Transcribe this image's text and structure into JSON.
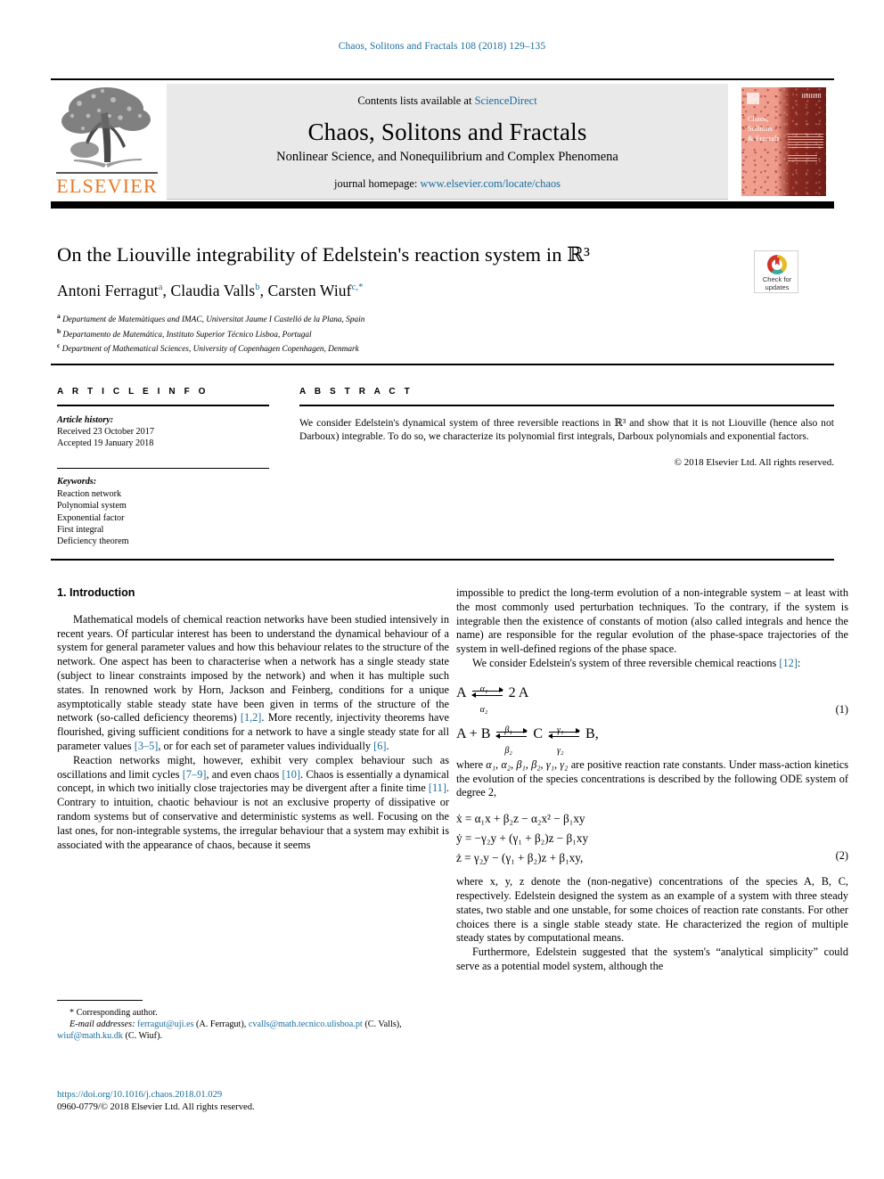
{
  "running_head": "Chaos, Solitons and Fractals 108 (2018) 129–135",
  "masthead": {
    "contents_prefix": "Contents lists available at ",
    "sciencedirect": "ScienceDirect",
    "journal_name": "Chaos, Solitons and Fractals",
    "journal_subtitle": "Nonlinear Science, and Nonequilibrium and Complex Phenomena",
    "homepage_prefix": "journal homepage: ",
    "homepage_url": "www.elsevier.com/locate/chaos",
    "publisher": "ELSEVIER",
    "cover_title": "Chaos,\nSolitons\n& Fractals",
    "link_color": "#1a6d9e",
    "elsevier_orange": "#E87722"
  },
  "crossmark": {
    "line1": "Check for",
    "line2": "updates"
  },
  "article": {
    "title": "On the Liouville integrability of Edelstein's reaction system in ℝ³",
    "authors": [
      {
        "name": "Antoni Ferragut",
        "mark": "a"
      },
      {
        "name": "Claudia Valls",
        "mark": "b"
      },
      {
        "name": "Carsten Wiuf",
        "mark": "c,*"
      }
    ],
    "affiliations": [
      {
        "mark": "a",
        "text": "Departament de Matemàtiques and IMAC, Universitat Jaume I Castelló de la Plana, Spain"
      },
      {
        "mark": "b",
        "text": "Departamento de Matemática, Instituto Superior Técnico Lisboa, Portugal"
      },
      {
        "mark": "c",
        "text": "Department of Mathematical Sciences, University of Copenhagen Copenhagen, Denmark"
      }
    ]
  },
  "info": {
    "heading": "A R T I C L E   I N F O",
    "history_label": "Article history:",
    "received": "Received 23 October 2017",
    "accepted": "Accepted 19 January 2018",
    "keywords_label": "Keywords:",
    "keywords": [
      "Reaction network",
      "Polynomial system",
      "Exponential factor",
      "First integral",
      "Deficiency theorem"
    ]
  },
  "abstract": {
    "heading": "A B S T R A C T",
    "text": "We consider Edelstein's dynamical system of three reversible reactions in ℝ³ and show that it is not Liouville (hence also not Darboux) integrable. To do so, we characterize its polynomial first integrals, Darboux polynomials and exponential factors.",
    "copyright": "© 2018 Elsevier Ltd. All rights reserved."
  },
  "body": {
    "section_heading": "1. Introduction",
    "left_p1_a": "Mathematical models of chemical reaction networks have been studied intensively in recent years. Of particular interest has been to understand the dynamical behaviour of a system for general parameter values and how this behaviour relates to the structure of the network. One aspect has been to characterise when a network has a single steady state (subject to linear constraints imposed by the network) and when it has multiple such states. In renowned work by Horn, Jackson and Feinberg, conditions for a unique asymptotically stable steady state have been given in terms of the structure of the network (so-called deficiency theorems) ",
    "ref_12": "[1,2]",
    "left_p1_b": ". More recently, injectivity theorems have flourished, giving sufficient conditions for a network to have a single steady state for all parameter values ",
    "ref_35": "[3–5]",
    "left_p1_c": ", or for each set of parameter values individually ",
    "ref_6": "[6]",
    "left_p1_d": ".",
    "left_p2_a": "Reaction networks might, however, exhibit very complex behaviour such as oscillations and limit cycles ",
    "ref_79": "[7–9]",
    "left_p2_b": ", and even chaos ",
    "ref_10": "[10]",
    "left_p2_c": ". Chaos is essentially a dynamical concept, in which two initially close trajectories may be divergent after a finite time ",
    "ref_11": "[11]",
    "left_p2_d": ". Contrary to intuition, chaotic behaviour is not an exclusive property of dissipative or random systems but of conservative and deterministic systems as well. Focusing on the last ones, for non-integrable systems, the irregular behaviour that a system may exhibit is associated with the appearance of chaos, because it seems",
    "right_p1": "impossible to predict the long-term evolution of a non-integrable system – at least with the most commonly used perturbation techniques. To the contrary, if the system is integrable then the existence of constants of motion (also called integrals and hence the name) are responsible for the regular evolution of the phase-space trajectories of the system in well-defined regions of the phase space.",
    "right_p2_a": "We consider Edelstein's system of three reversible chemical reactions ",
    "ref_12b": "[12]",
    "right_p2_b": ":",
    "right_p3_a": "where ",
    "right_p3_params": "α₁, α₂, β₁, β₂, γ₁, γ₂",
    "right_p3_b": " are positive reaction rate constants. Under mass-action kinetics the evolution of the species concentrations is described by the following ODE system of degree 2,",
    "right_p4": "where x, y, z denote the (non-negative) concentrations of the species A, B, C, respectively. Edelstein designed the system as an example of a system with three steady states, two stable and one unstable, for some choices of reaction rate constants. For other choices there is a single stable steady state. He characterized the region of multiple steady states by computational means.",
    "right_p5": "Furthermore, Edelstein suggested that the system's “analytical simplicity” could serve as a potential model system, although the"
  },
  "equations": {
    "eq1": {
      "number": "(1)",
      "line1_left": "A",
      "line1_top": "α₁",
      "line1_bot": "α₂",
      "line1_right": "2 A",
      "line2_left": "A + B",
      "line2_top_1": "β₁",
      "line2_bot_1": "β₂",
      "line2_mid": "C",
      "line2_top_2": "γ₁",
      "line2_bot_2": "γ₂",
      "line2_right": "B,"
    },
    "eq2": {
      "number": "(2)",
      "line1": "ẋ = α₁x + β₂z − α₂x² − β₁xy",
      "line2": "ẏ = −γ₂y + (γ₁ + β₂)z − β₁xy",
      "line3": "ż = γ₂y − (γ₁ + β₂)z + β₁xy,"
    }
  },
  "footnote": {
    "corresponding": "* Corresponding author.",
    "emails_label": "E-mail addresses:",
    "email1": "ferragut@uji.es",
    "email1_who": " (A. Ferragut), ",
    "email2": "cvalls@math.tecnico.ulisboa.pt",
    "email2_who": " (C. Valls), ",
    "email3": "wiuf@math.ku.dk",
    "email3_who": " (C. Wiuf)."
  },
  "doi_block": {
    "doi": "https://doi.org/10.1016/j.chaos.2018.01.029",
    "issn_line": "0960-0779/© 2018 Elsevier Ltd. All rights reserved."
  }
}
